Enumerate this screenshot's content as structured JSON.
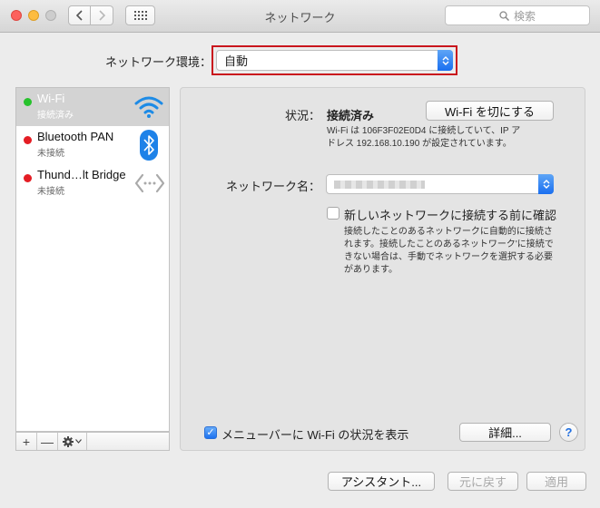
{
  "window": {
    "title": "ネットワーク",
    "search_placeholder": "検索"
  },
  "location": {
    "label": "ネットワーク環境：",
    "value": "自動"
  },
  "services": [
    {
      "name": "Wi-Fi",
      "status": "接続済み",
      "state": "connected",
      "icon": "wifi-icon"
    },
    {
      "name": "Bluetooth PAN",
      "status": "未接続",
      "state": "disconnected",
      "icon": "bluetooth-icon"
    },
    {
      "name": "Thund…lt Bridge",
      "status": "未接続",
      "state": "disconnected",
      "icon": "bridge-icon"
    }
  ],
  "sidebar_tools": {
    "add": "+",
    "remove": "—"
  },
  "detail": {
    "status_label": "状況：",
    "status_value": "接続済み",
    "turn_off_button": "Wi-Fi を切にする",
    "status_desc_line1": "Wi-Fi は 106F3F02E0D4 に接続していて、IP ア",
    "status_desc_line2": "ドレス 192.168.10.190 が設定されています。",
    "network_name_label": "ネットワーク名：",
    "ask_join_label": "新しいネットワークに接続する前に確認",
    "ask_join_checked": false,
    "ask_desc_line1": "接続したことのあるネットワークに自動的に接続さ",
    "ask_desc_line2": "れます。接続したことのあるネットワーク'に接続で",
    "ask_desc_line3": "きない場合は、手動でネットワークを選択する必要",
    "ask_desc_line4": "があります。",
    "menubar_label": "メニューバーに Wi-Fi の状況を表示",
    "menubar_checked": true,
    "advanced_button": "詳細...",
    "help": "?"
  },
  "footer": {
    "assistant_button": "アシスタント...",
    "revert_button": "元に戻す",
    "apply_button": "適用"
  },
  "colors": {
    "accent": "#1a6ff0",
    "highlight_frame": "#c9161d",
    "connected": "#27c22c",
    "disconnected": "#e41d24"
  }
}
